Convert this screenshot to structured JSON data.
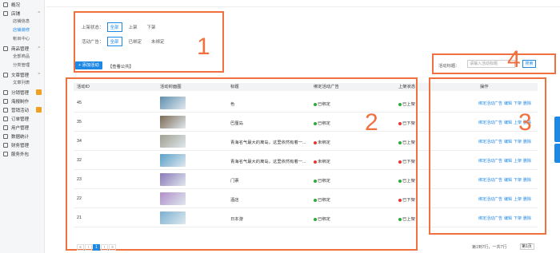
{
  "sidebar": {
    "groups": [
      {
        "label": "概况",
        "expanded": false,
        "badge": false,
        "subs": []
      },
      {
        "label": "店铺",
        "expanded": true,
        "badge": false,
        "subs": [
          {
            "label": "店铺信息",
            "active": false
          },
          {
            "label": "店铺装修",
            "active": true
          },
          {
            "label": "帐目中心",
            "active": false
          }
        ]
      },
      {
        "label": "商品管理",
        "expanded": true,
        "badge": false,
        "subs": [
          {
            "label": "全部商品",
            "active": false
          },
          {
            "label": "分类管理",
            "active": false
          }
        ]
      },
      {
        "label": "文章管理",
        "expanded": true,
        "badge": false,
        "subs": [
          {
            "label": "文章列表",
            "active": false
          }
        ]
      },
      {
        "label": "分销管理",
        "expanded": false,
        "badge": true,
        "subs": []
      },
      {
        "label": "海报制作",
        "expanded": false,
        "badge": false,
        "subs": []
      },
      {
        "label": "营销活动",
        "expanded": false,
        "badge": true,
        "subs": []
      },
      {
        "label": "订单管理",
        "expanded": false,
        "badge": false,
        "subs": []
      },
      {
        "label": "用户管理",
        "expanded": false,
        "badge": false,
        "subs": []
      },
      {
        "label": "数据统计",
        "expanded": false,
        "badge": false,
        "subs": []
      },
      {
        "label": "财务管理",
        "expanded": false,
        "badge": false,
        "subs": []
      },
      {
        "label": "服务外包",
        "expanded": false,
        "badge": false,
        "subs": []
      }
    ]
  },
  "filters": {
    "status_label": "上架状态：",
    "status_options": [
      "全部",
      "上架",
      "下架"
    ],
    "status_selected": 0,
    "ad_label": "活动广告：",
    "ad_options": [
      "全部",
      "已绑定",
      "未绑定"
    ],
    "ad_selected": 0
  },
  "toolbar": {
    "add_button": "+ 添加活动",
    "view_link": "【查看公共】"
  },
  "search": {
    "label": "活动标题：",
    "placeholder": "请输入活动标题",
    "button": "搜索"
  },
  "table": {
    "headers": [
      "活动ID",
      "活动封面图",
      "标题",
      "绑定活动广告",
      "上架状态",
      "操作"
    ],
    "rows": [
      {
        "id": "45",
        "title": "色",
        "ad": "已绑定",
        "ad_color": "#2eaa3c",
        "status": "已上架",
        "status_color": "#2eaa3c",
        "toggle": "下架",
        "thumb": "#5f8fb0"
      },
      {
        "id": "35",
        "title": "巴厘岛",
        "ad": "已绑定",
        "ad_color": "#2eaa3c",
        "status": "已下架",
        "status_color": "#e53935",
        "toggle": "上架",
        "thumb": "#7d6a55"
      },
      {
        "id": "34",
        "title": "青海名气最大的离岛，这里依然有着一...",
        "ad": "未绑定",
        "ad_color": "#e53935",
        "status": "已上架",
        "status_color": "#2eaa3c",
        "toggle": "下架",
        "thumb": "#a0a090"
      },
      {
        "id": "32",
        "title": "青海名气最大的离岛，这里依然有着一...",
        "ad": "未绑定",
        "ad_color": "#e53935",
        "status": "已下架",
        "status_color": "#e53935",
        "toggle": "上架",
        "thumb": "#5aa0c8"
      },
      {
        "id": "23",
        "title": "门票",
        "ad": "已绑定",
        "ad_color": "#2eaa3c",
        "status": "已上架",
        "status_color": "#2eaa3c",
        "toggle": "下架",
        "thumb": "#8a78b8"
      },
      {
        "id": "22",
        "title": "酒店",
        "ad": "已绑定",
        "ad_color": "#2eaa3c",
        "status": "已下架",
        "status_color": "#e53935",
        "toggle": "上架",
        "thumb": "#b08fc8"
      },
      {
        "id": "21",
        "title": "日本游",
        "ad": "已绑定",
        "ad_color": "#2eaa3c",
        "status": "已上架",
        "status_color": "#2eaa3c",
        "toggle": "下架",
        "thumb": "#7ab0d0"
      }
    ],
    "op_bind": "绑定活动广告",
    "op_edit": "编辑",
    "op_delete": "删除"
  },
  "pagination": {
    "prev_first": "«",
    "prev": "‹",
    "current": "1",
    "next": "›",
    "next_last": "»",
    "info": "第1到7行，一共7行",
    "page_size": "第1页"
  },
  "annotations": [
    "1",
    "2",
    "3",
    "4"
  ],
  "colors": {
    "accent": "#1e88e5",
    "annotation": "#f07040"
  }
}
